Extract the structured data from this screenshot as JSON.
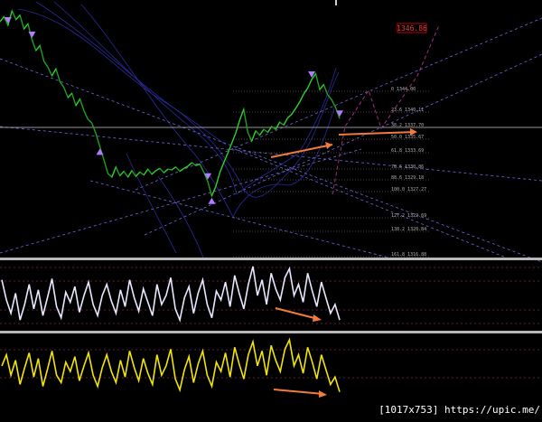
{
  "watermark": "[1017x753] https://upic.me/",
  "colors": {
    "background": "#000000",
    "price": "#1f9e1f",
    "price_bright": "#2fd02f",
    "bands": "#2a2a9a",
    "trend": "#6b6bd8",
    "fib": "#8a8a8a",
    "projection": "#a0307a",
    "arrow": "#f07b3a",
    "marker": "#b07cff",
    "osc1": "#e8e8ff",
    "osc2": "#f2e500",
    "separator": "#b8b8b8",
    "osc_levels": "#7a2a4a",
    "price_tag_bg": "#c00000"
  },
  "price_tag": "1346.86",
  "fib_levels": [
    {
      "label": "0  1344.00"
    },
    {
      "label": "23.6  1340.11"
    },
    {
      "label": "38.2  1337.70"
    },
    {
      "label": "50.0  1335.67"
    },
    {
      "label": "61.8  1333.69"
    },
    {
      "label": "78.6  1330.86"
    },
    {
      "label": "88.6  1329.18"
    },
    {
      "label": "100.0  1327.27"
    },
    {
      "label": "127.2  1322.69"
    },
    {
      "label": "138.2  1320.84"
    },
    {
      "label": "161.8  1316.88"
    }
  ],
  "chart_data": [
    {
      "type": "line",
      "panel": "price",
      "title": "",
      "xlabel": "",
      "ylabel": "",
      "series": [
        {
          "values": [
            1351.5,
            1352.2,
            1351.0,
            1353.0,
            1351.8,
            1352.4,
            1350.5,
            1351.2,
            1349.0,
            1347.5,
            1348.2,
            1346.0,
            1345.2,
            1344.0,
            1345.0,
            1343.2,
            1342.4,
            1341.0,
            1341.6,
            1339.9,
            1340.8,
            1339.2,
            1338.0,
            1337.5,
            1336.0,
            1334.2,
            1332.4,
            1330.5,
            1330.0,
            1331.4,
            1330.2,
            1330.8,
            1330.0,
            1330.9,
            1330.1,
            1330.7,
            1330.3,
            1331.1,
            1330.4,
            1330.9,
            1331.2,
            1330.6,
            1331.1,
            1331.0,
            1331.4,
            1330.8,
            1331.2,
            1331.5,
            1332.0,
            1331.6,
            1331.8,
            1330.7,
            1329.4,
            1327.4,
            1328.7,
            1330.6,
            1332.0,
            1333.3,
            1334.7,
            1336.1,
            1337.9,
            1339.4,
            1336.2,
            1335.0,
            1336.4,
            1335.8,
            1336.6,
            1336.2,
            1337.0,
            1336.6,
            1337.6,
            1337.2,
            1338.2,
            1338.7,
            1339.5,
            1340.4,
            1341.5,
            1342.3,
            1343.5,
            1344.3,
            1342.1,
            1342.8,
            1341.4,
            1340.7,
            1339.6,
            1338.1
          ]
        }
      ]
    },
    {
      "type": "line",
      "panel": "oscillator-1",
      "title": "",
      "series": [
        {
          "values": [
            44,
            26,
            14,
            32,
            8,
            22,
            40,
            18,
            35,
            12,
            28,
            45,
            20,
            10,
            33,
            24,
            38,
            15,
            30,
            42,
            22,
            12,
            30,
            40,
            25,
            14,
            35,
            20,
            44,
            28,
            16,
            36,
            24,
            12,
            40,
            22,
            30,
            46,
            18,
            8,
            28,
            38,
            14,
            32,
            44,
            22,
            10,
            34,
            26,
            42,
            20,
            48,
            32,
            18,
            40,
            56,
            30,
            44,
            22,
            50,
            36,
            26,
            46,
            54,
            30,
            40,
            24,
            50,
            34,
            20,
            42,
            28,
            14,
            22,
            8
          ]
        }
      ]
    },
    {
      "type": "line",
      "panel": "oscillator-2",
      "title": "",
      "series": [
        {
          "values": [
            40,
            52,
            30,
            46,
            20,
            38,
            54,
            28,
            48,
            18,
            36,
            56,
            30,
            22,
            44,
            34,
            50,
            24,
            40,
            54,
            30,
            18,
            38,
            52,
            34,
            22,
            46,
            28,
            56,
            38,
            24,
            48,
            32,
            20,
            52,
            30,
            40,
            58,
            26,
            14,
            36,
            50,
            22,
            42,
            56,
            30,
            18,
            44,
            34,
            54,
            28,
            60,
            42,
            26,
            52,
            66,
            40,
            56,
            30,
            62,
            46,
            34,
            58,
            68,
            40,
            52,
            32,
            60,
            44,
            26,
            52,
            36,
            20,
            28,
            12
          ]
        }
      ]
    }
  ]
}
